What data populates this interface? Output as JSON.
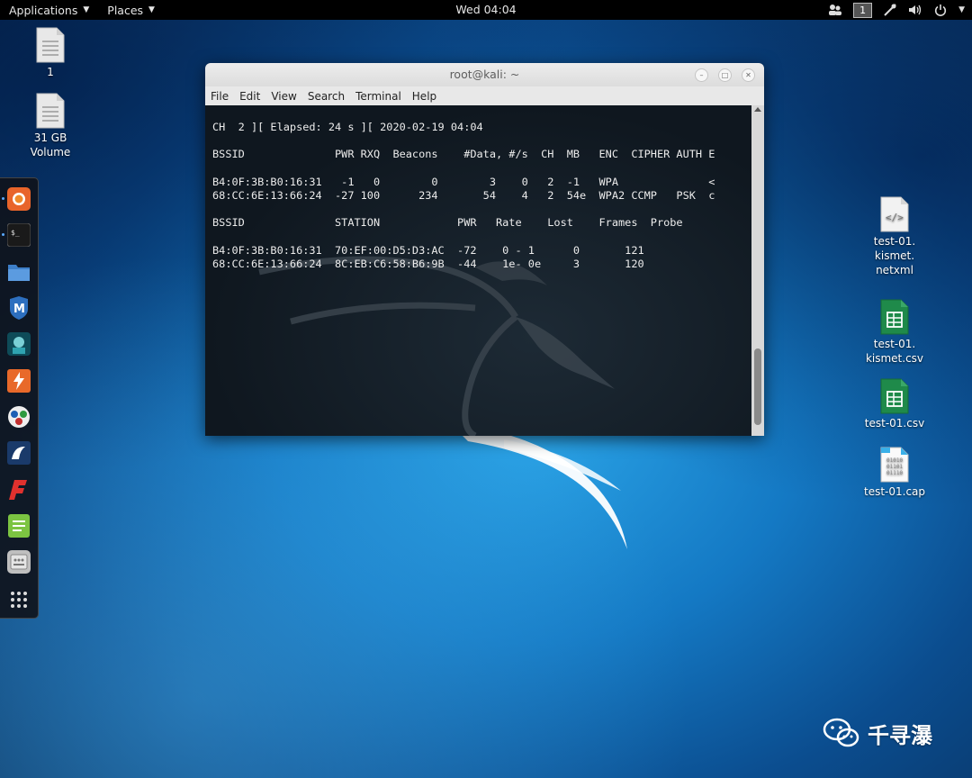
{
  "topbar": {
    "applications": "Applications",
    "places": "Places",
    "clock": "Wed 04:04",
    "workspace": "1"
  },
  "desktop": {
    "left_icons": [
      {
        "label": "1",
        "icon": "text-file-icon"
      },
      {
        "label": "31 GB\nVolume",
        "icon": "drive-icon"
      }
    ],
    "right_icons": [
      {
        "label": "test-01.\nkismet.\nnetxml",
        "icon": "xml-file-icon"
      },
      {
        "label": "test-01.\nkismet.csv",
        "icon": "spreadsheet-icon"
      },
      {
        "label": "test-01.csv",
        "icon": "spreadsheet-icon"
      },
      {
        "label": "test-01.cap",
        "icon": "binary-file-icon"
      }
    ]
  },
  "dock": {
    "items": [
      "firefox-icon",
      "terminal-icon",
      "files-icon",
      "metasploit-icon",
      "armitage-icon",
      "burpsuite-icon",
      "maltego-icon",
      "beef-icon",
      "faraday-icon",
      "text-editor-icon",
      "settings-icon",
      "app-grid-icon"
    ]
  },
  "terminal": {
    "title": "root@kali: ~",
    "menu": [
      "File",
      "Edit",
      "View",
      "Search",
      "Terminal",
      "Help"
    ],
    "lines": [
      "CH  2 ][ Elapsed: 24 s ][ 2020-02-19 04:04",
      "",
      "BSSID              PWR RXQ  Beacons    #Data, #/s  CH  MB   ENC  CIPHER AUTH E",
      "",
      "B4:0F:3B:B0:16:31   -1   0        0        3    0   2  -1   WPA              <",
      "68:CC:6E:13:66:24  -27 100      234       54    4   2  54e  WPA2 CCMP   PSK  c",
      "",
      "BSSID              STATION            PWR   Rate    Lost    Frames  Probe",
      "",
      "B4:0F:3B:B0:16:31  70:EF:00:D5:D3:AC  -72    0 - 1      0       121",
      "68:CC:6E:13:66:24  8C:EB:C6:58:B6:9B  -44    1e- 0e     3       120"
    ]
  },
  "watermark": "千寻瀑",
  "colors": {
    "topbar_bg": "#000000",
    "terminal_bg": "#121a22",
    "desktop_blue": "#1479c4"
  }
}
